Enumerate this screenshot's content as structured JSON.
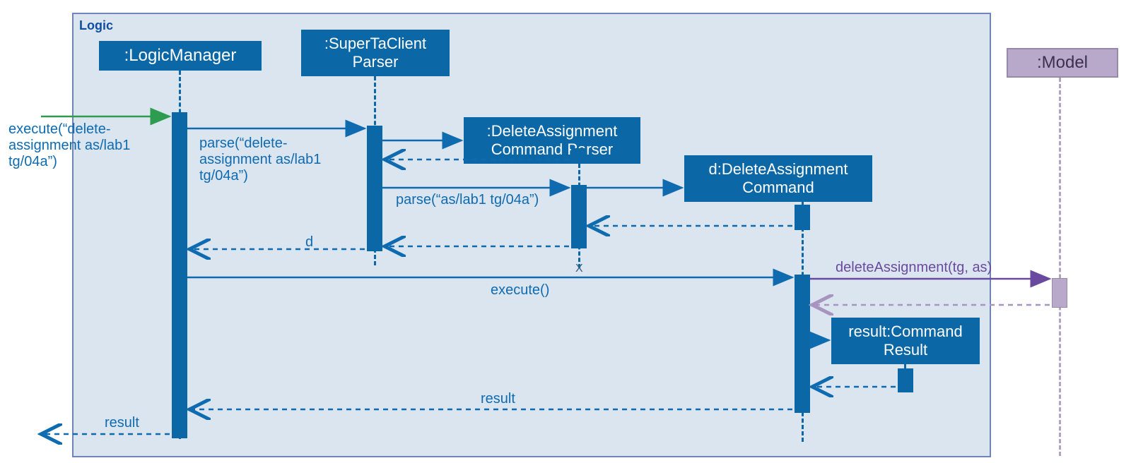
{
  "frame": {
    "label": "Logic"
  },
  "participants": {
    "logic_manager": ":LogicManager",
    "parser": ":SuperTaClient\nParser",
    "del_parser": ":DeleteAssignment\nCommand Parser",
    "del_cmd": "d:DeleteAssignment\nCommand",
    "cmd_result": "result:Command\nResult",
    "model": ":Model"
  },
  "messages": {
    "execute_call": "execute(“delete-\nassignment as/lab1\ntg/04a”)",
    "parse_main": "parse(“delete-\nassignment as/lab1\ntg/04a”)",
    "parse_sub": "parse(“as/lab1 tg/04a”)",
    "d_return": "d",
    "execute_cmd": "execute()",
    "delete_assign": "deleteAssignment(tg, as)",
    "result_msg": "result",
    "result_out": "result"
  }
}
